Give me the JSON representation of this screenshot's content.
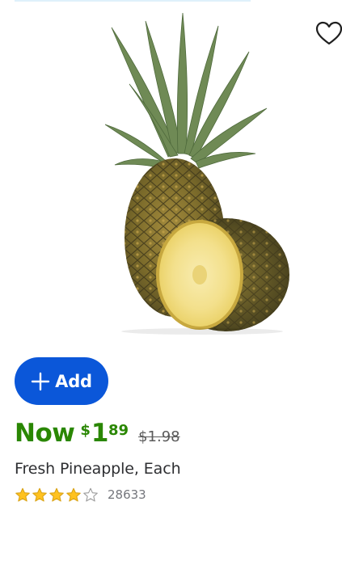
{
  "product": {
    "title": "Fresh Pineapple, Each",
    "image_icon": "pineapple-image",
    "favorite_icon": "heart-outline-icon"
  },
  "actions": {
    "add_label": "Add",
    "add_icon": "plus-icon"
  },
  "price": {
    "now_label": "Now",
    "currency": "$",
    "dollars": "1",
    "cents": "89",
    "was_price": "$1.98"
  },
  "rating": {
    "stars": 4,
    "max_stars": 5,
    "review_count": "28633"
  },
  "colors": {
    "accent_blue": "#0b57d9",
    "price_green": "#2a8703",
    "star_gold": "#ffc220",
    "text_dark": "#2e2f32",
    "text_muted": "#74767c"
  }
}
